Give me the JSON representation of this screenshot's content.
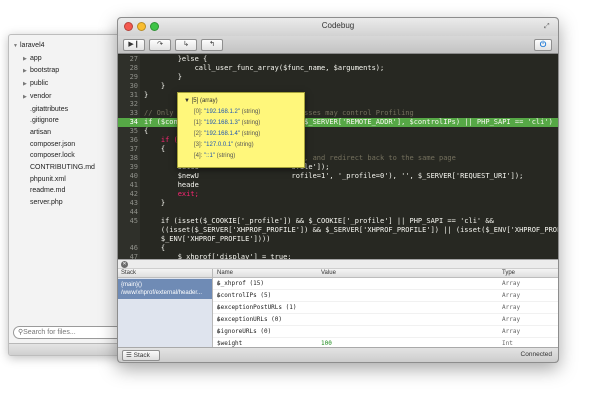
{
  "files": {
    "root": "laravel4",
    "items": [
      {
        "label": "app",
        "kind": "folder"
      },
      {
        "label": "bootstrap",
        "kind": "folder"
      },
      {
        "label": "public",
        "kind": "folder"
      },
      {
        "label": "vendor",
        "kind": "folder"
      },
      {
        "label": ".gitattributes",
        "kind": "file"
      },
      {
        "label": ".gitignore",
        "kind": "file"
      },
      {
        "label": "artisan",
        "kind": "file"
      },
      {
        "label": "composer.json",
        "kind": "file"
      },
      {
        "label": "composer.lock",
        "kind": "file"
      },
      {
        "label": "CONTRIBUTING.md",
        "kind": "file"
      },
      {
        "label": "phpunit.xml",
        "kind": "file"
      },
      {
        "label": "readme.md",
        "kind": "file"
      },
      {
        "label": "server.php",
        "kind": "file"
      }
    ],
    "search_placeholder": "Search for files..."
  },
  "window": {
    "title": "Codebug"
  },
  "toolbar": {
    "buttons": [
      "run-icon",
      "step-over-icon",
      "step-into-icon",
      "step-out-icon"
    ],
    "power": "power-icon"
  },
  "editor": {
    "lines": [
      {
        "n": "27",
        "segs": [
          {
            "t": "        }else {",
            "c": "var"
          }
        ]
      },
      {
        "n": "28",
        "segs": [
          {
            "t": "            call_user_func_array($func_name, $arguments);",
            "c": "var"
          }
        ]
      },
      {
        "n": "29",
        "segs": [
          {
            "t": "        }",
            "c": "var"
          }
        ]
      },
      {
        "n": "30",
        "segs": [
          {
            "t": "    }",
            "c": "var"
          }
        ]
      },
      {
        "n": "31",
        "segs": [
          {
            "t": "}",
            "c": "var"
          }
        ]
      },
      {
        "n": "32",
        "segs": [
          {
            "t": "",
            "c": "var"
          }
        ]
      },
      {
        "n": "33",
        "segs": [
          {
            "t": "// Only users from authorized IP addresses may control Profiling",
            "c": "cm"
          }
        ]
      },
      {
        "n": "34",
        "segs": [
          {
            "t": "if ($controlIPs === false || in_array($_SERVER['REMOTE_ADDR'], $controlIPs) || PHP_SAPI == 'cli')",
            "c": "var"
          }
        ],
        "hl": true
      },
      {
        "n": "35",
        "segs": [
          {
            "t": "{",
            "c": "var"
          }
        ]
      },
      {
        "n": "36",
        "segs": [
          {
            "t": "    if (isset(",
            "c": "kw"
          }
        ]
      },
      {
        "n": "37",
        "segs": [
          {
            "t": "    {",
            "c": "var"
          }
        ]
      },
      {
        "n": "38",
        "segs": [
          {
            "t": "        //Give                     tus, and redirect back to the same page",
            "c": "cm"
          }
        ]
      },
      {
        "n": "39",
        "segs": [
          {
            "t": "        setco                      ofile']);",
            "c": "var"
          }
        ]
      },
      {
        "n": "40",
        "segs": [
          {
            "t": "        $newU                      rofile=1', '_profile=0'), '', $_SERVER['REQUEST_URI']);",
            "c": "var"
          }
        ]
      },
      {
        "n": "41",
        "segs": [
          {
            "t": "        heade",
            "c": "var"
          }
        ]
      },
      {
        "n": "42",
        "segs": [
          {
            "t": "        exit;",
            "c": "kw"
          }
        ]
      },
      {
        "n": "43",
        "segs": [
          {
            "t": "    }",
            "c": "var"
          }
        ]
      },
      {
        "n": "44",
        "segs": [
          {
            "t": "",
            "c": "var"
          }
        ]
      },
      {
        "n": "45",
        "segs": [
          {
            "t": "    if (isset($_COOKIE['_profile']) && $_COOKIE['_profile'] || PHP_SAPI == 'cli' &&",
            "c": "var"
          }
        ]
      },
      {
        "n": "",
        "segs": [
          {
            "t": "    ((isset($_SERVER['XHPROF_PROFILE']) && $_SERVER['XHPROF_PROFILE']) || (isset($_ENV['XHPROF_PROFILE']) &&",
            "c": "var"
          }
        ]
      },
      {
        "n": "",
        "segs": [
          {
            "t": "    $_ENV['XHPROF_PROFILE'])))",
            "c": "var"
          }
        ]
      },
      {
        "n": "46",
        "segs": [
          {
            "t": "    {",
            "c": "var"
          }
        ]
      },
      {
        "n": "47",
        "segs": [
          {
            "t": "        $_xhprof['display'] = true;",
            "c": "var"
          }
        ]
      }
    ]
  },
  "tooltip": {
    "header": "[5] (array)",
    "items": [
      {
        "k": "[0]:",
        "v": "\"192.168.1.2\"",
        "t": "(string)"
      },
      {
        "k": "[1]:",
        "v": "\"192.168.1.3\"",
        "t": "(string)"
      },
      {
        "k": "[2]:",
        "v": "\"192.168.1.4\"",
        "t": "(string)"
      },
      {
        "k": "[3]:",
        "v": "\"127.0.0.1\"",
        "t": "(string)"
      },
      {
        "k": "[4]:",
        "v": "\"::1\"",
        "t": "(string)"
      }
    ]
  },
  "panel": {
    "stack_header": "Stack",
    "frame_line1": "{main}()",
    "frame_line2": "/www/xhprof/external/header...",
    "columns": {
      "name": "Name",
      "value": "Value",
      "type": "Type"
    },
    "rows": [
      {
        "name": "$_xhprof (15)",
        "value": "",
        "type": "Array",
        "expand": true
      },
      {
        "name": "$controlIPs (5)",
        "value": "",
        "type": "Array",
        "expand": true
      },
      {
        "name": "$exceptionPostURLs (1)",
        "value": "",
        "type": "Array",
        "expand": true
      },
      {
        "name": "$exceptionURLs (0)",
        "value": "",
        "type": "Array",
        "expand": true
      },
      {
        "name": "$ignoreURLs (0)",
        "value": "",
        "type": "Array",
        "expand": true
      },
      {
        "name": "$weight",
        "value": "100",
        "type": "Int",
        "expand": false
      }
    ]
  },
  "status": {
    "stack_button": "Stack",
    "connection": "Connected"
  }
}
